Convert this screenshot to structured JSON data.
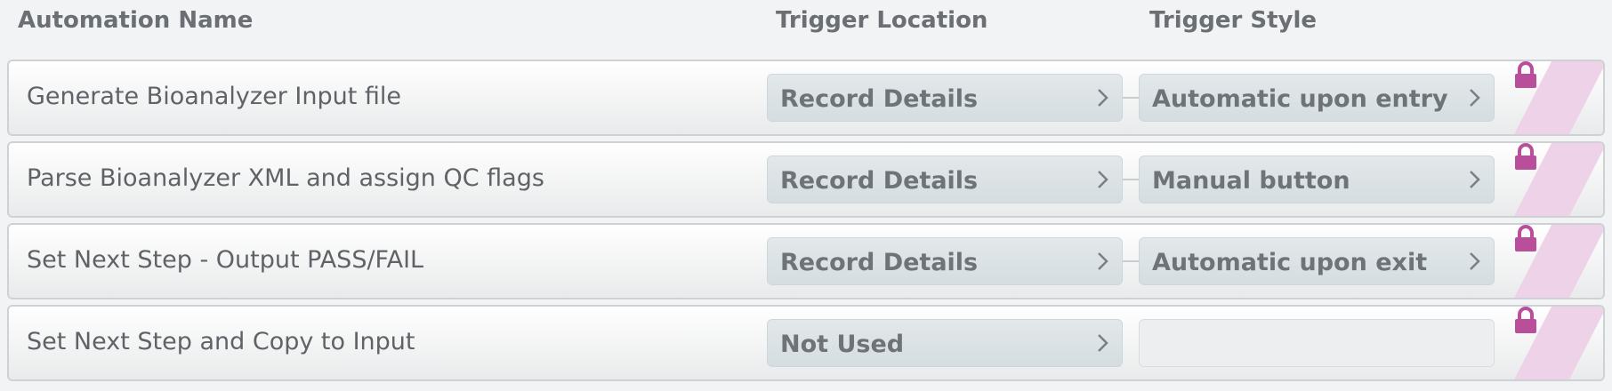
{
  "header": {
    "name": "Automation Name",
    "location": "Trigger Location",
    "style": "Trigger Style"
  },
  "rows": [
    {
      "name": "Generate Bioanalyzer Input file",
      "location": "Record Details",
      "style": "Automatic upon entry"
    },
    {
      "name": "Parse Bioanalyzer XML and assign QC flags",
      "location": "Record Details",
      "style": "Manual button"
    },
    {
      "name": "Set Next Step - Output PASS/FAIL",
      "location": "Record Details",
      "style": "Automatic upon exit"
    },
    {
      "name": "Set Next Step and Copy to Input",
      "location": "Not Used",
      "style": ""
    }
  ],
  "icons": {
    "chevron": "chevron-right-icon",
    "lock": "lock-icon"
  },
  "colors": {
    "lock": "#b94f9a",
    "stripe": "#eed3e8"
  }
}
